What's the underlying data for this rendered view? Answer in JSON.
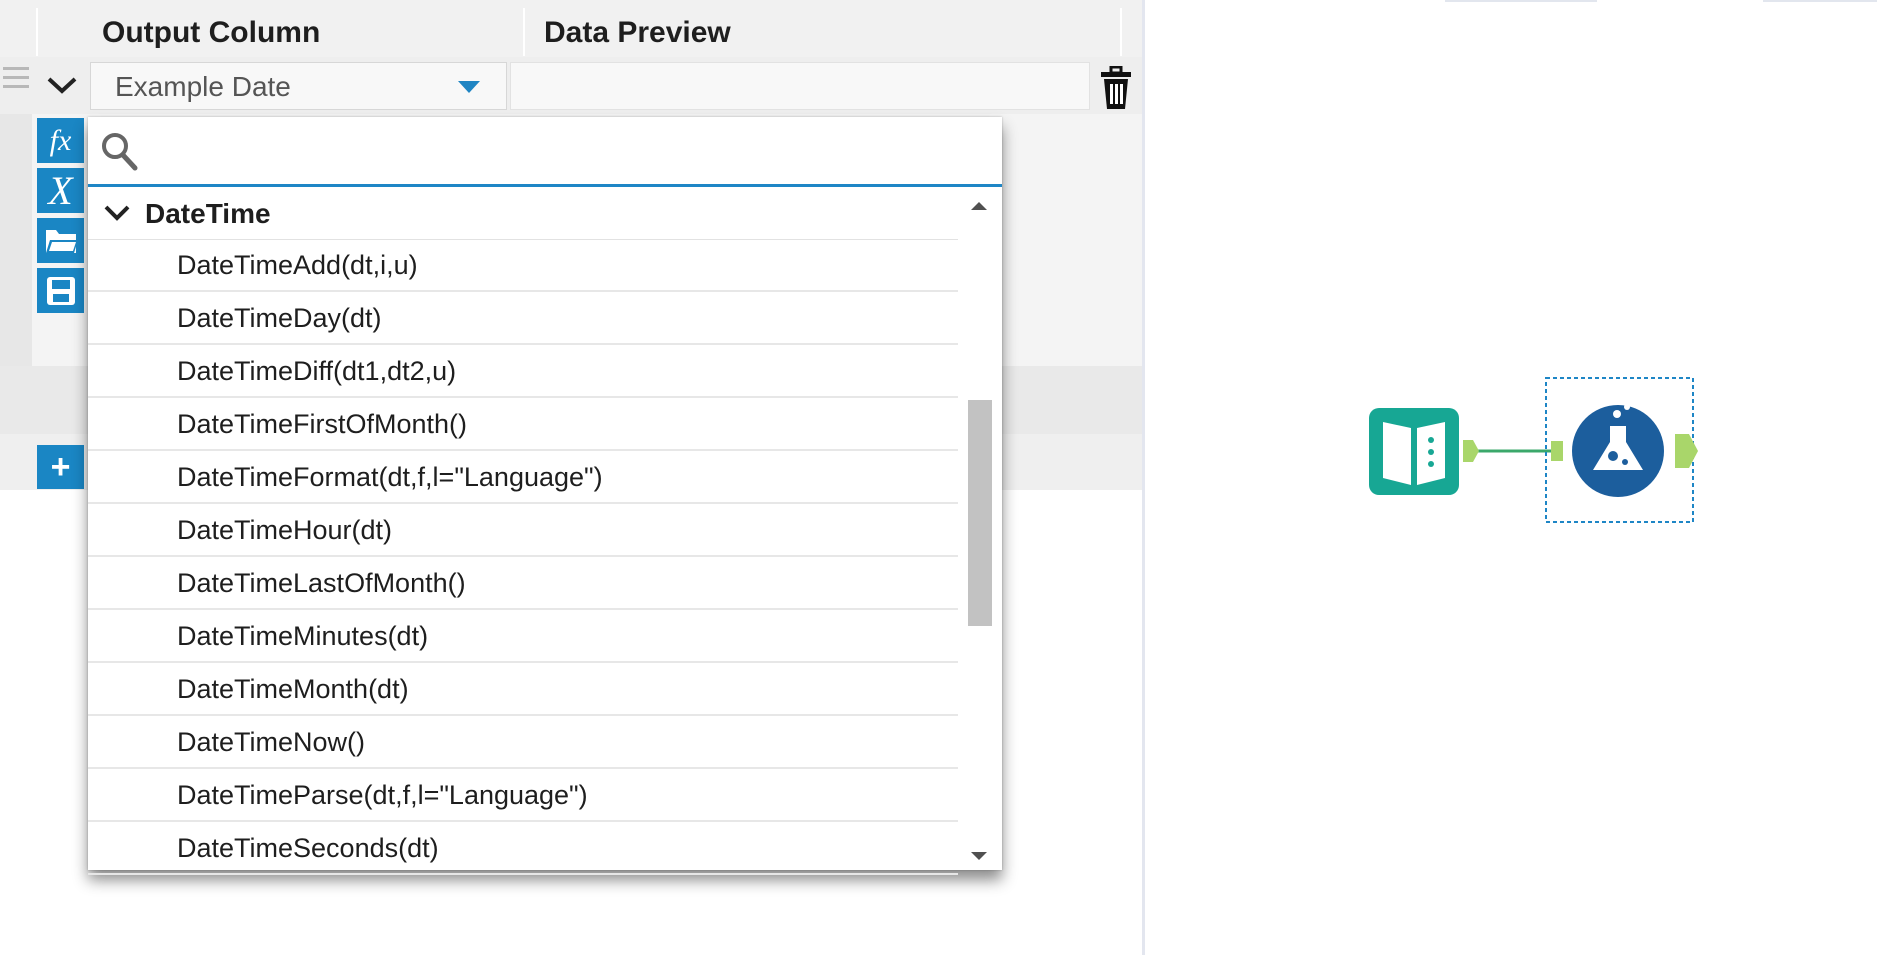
{
  "header": {
    "output_column": "Output Column",
    "data_preview": "Data Preview"
  },
  "expression_row": {
    "selected_column": "Example Date",
    "preview_value": ""
  },
  "toolbar": {
    "items": [
      {
        "icon": "fx-icon"
      },
      {
        "icon": "variable-x-icon"
      },
      {
        "icon": "open-folder-icon"
      },
      {
        "icon": "save-icon"
      }
    ],
    "add_label": "+"
  },
  "function_popup": {
    "search_placeholder": "",
    "category": "DateTime",
    "functions": [
      "DateTimeAdd(dt,i,u)",
      "DateTimeDay(dt)",
      "DateTimeDiff(dt1,dt2,u)",
      "DateTimeFirstOfMonth()",
      "DateTimeFormat(dt,f,l=\"Language\")",
      "DateTimeHour(dt)",
      "DateTimeLastOfMonth()",
      "DateTimeMinutes(dt)",
      "DateTimeMonth(dt)",
      "DateTimeNow()",
      "DateTimeParse(dt,f,l=\"Language\")",
      "DateTimeSeconds(dt)"
    ]
  },
  "canvas": {
    "tools": [
      {
        "icon": "input-book-icon",
        "color": "#17a794"
      },
      {
        "icon": "formula-flask-icon",
        "color": "#1c5e9d"
      }
    ],
    "connector_color": "#3ba86b",
    "anchor_color": "#a9d66a"
  },
  "colors": {
    "accent": "#1a86c4",
    "selection_border": "#1e86c6"
  }
}
